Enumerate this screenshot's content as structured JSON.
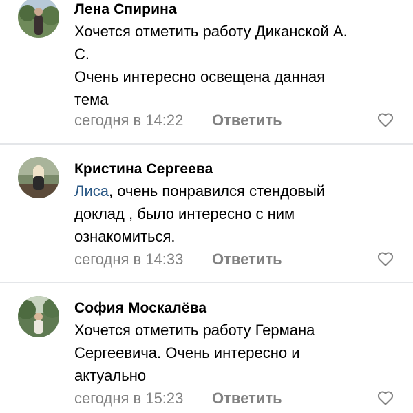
{
  "comments": [
    {
      "author": "Лена Спирина",
      "text_lines": [
        "Хочется отметить работу Диканской А.",
        "С.",
        "Очень интересно освещена данная",
        "тема"
      ],
      "time": "сегодня в 14:22",
      "reply_label": "Ответить"
    },
    {
      "author": "Кристина Сергеева",
      "mention": "Лиса",
      "text_lines": [
        ", очень понравился стендовый",
        "доклад , было интересно с ним",
        "ознакомиться."
      ],
      "time": "сегодня в 14:33",
      "reply_label": "Ответить"
    },
    {
      "author": "София Москалёва",
      "text_lines": [
        "Хочется отметить работу Германа",
        "Сергеевича. Очень интересно и",
        "актуально"
      ],
      "time": "сегодня в 15:23",
      "reply_label": "Ответить"
    }
  ],
  "icons": {
    "like": "heart-outline-icon"
  },
  "colors": {
    "mention": "#2a5885",
    "meta": "#828282",
    "divider": "#e4e6e9"
  }
}
